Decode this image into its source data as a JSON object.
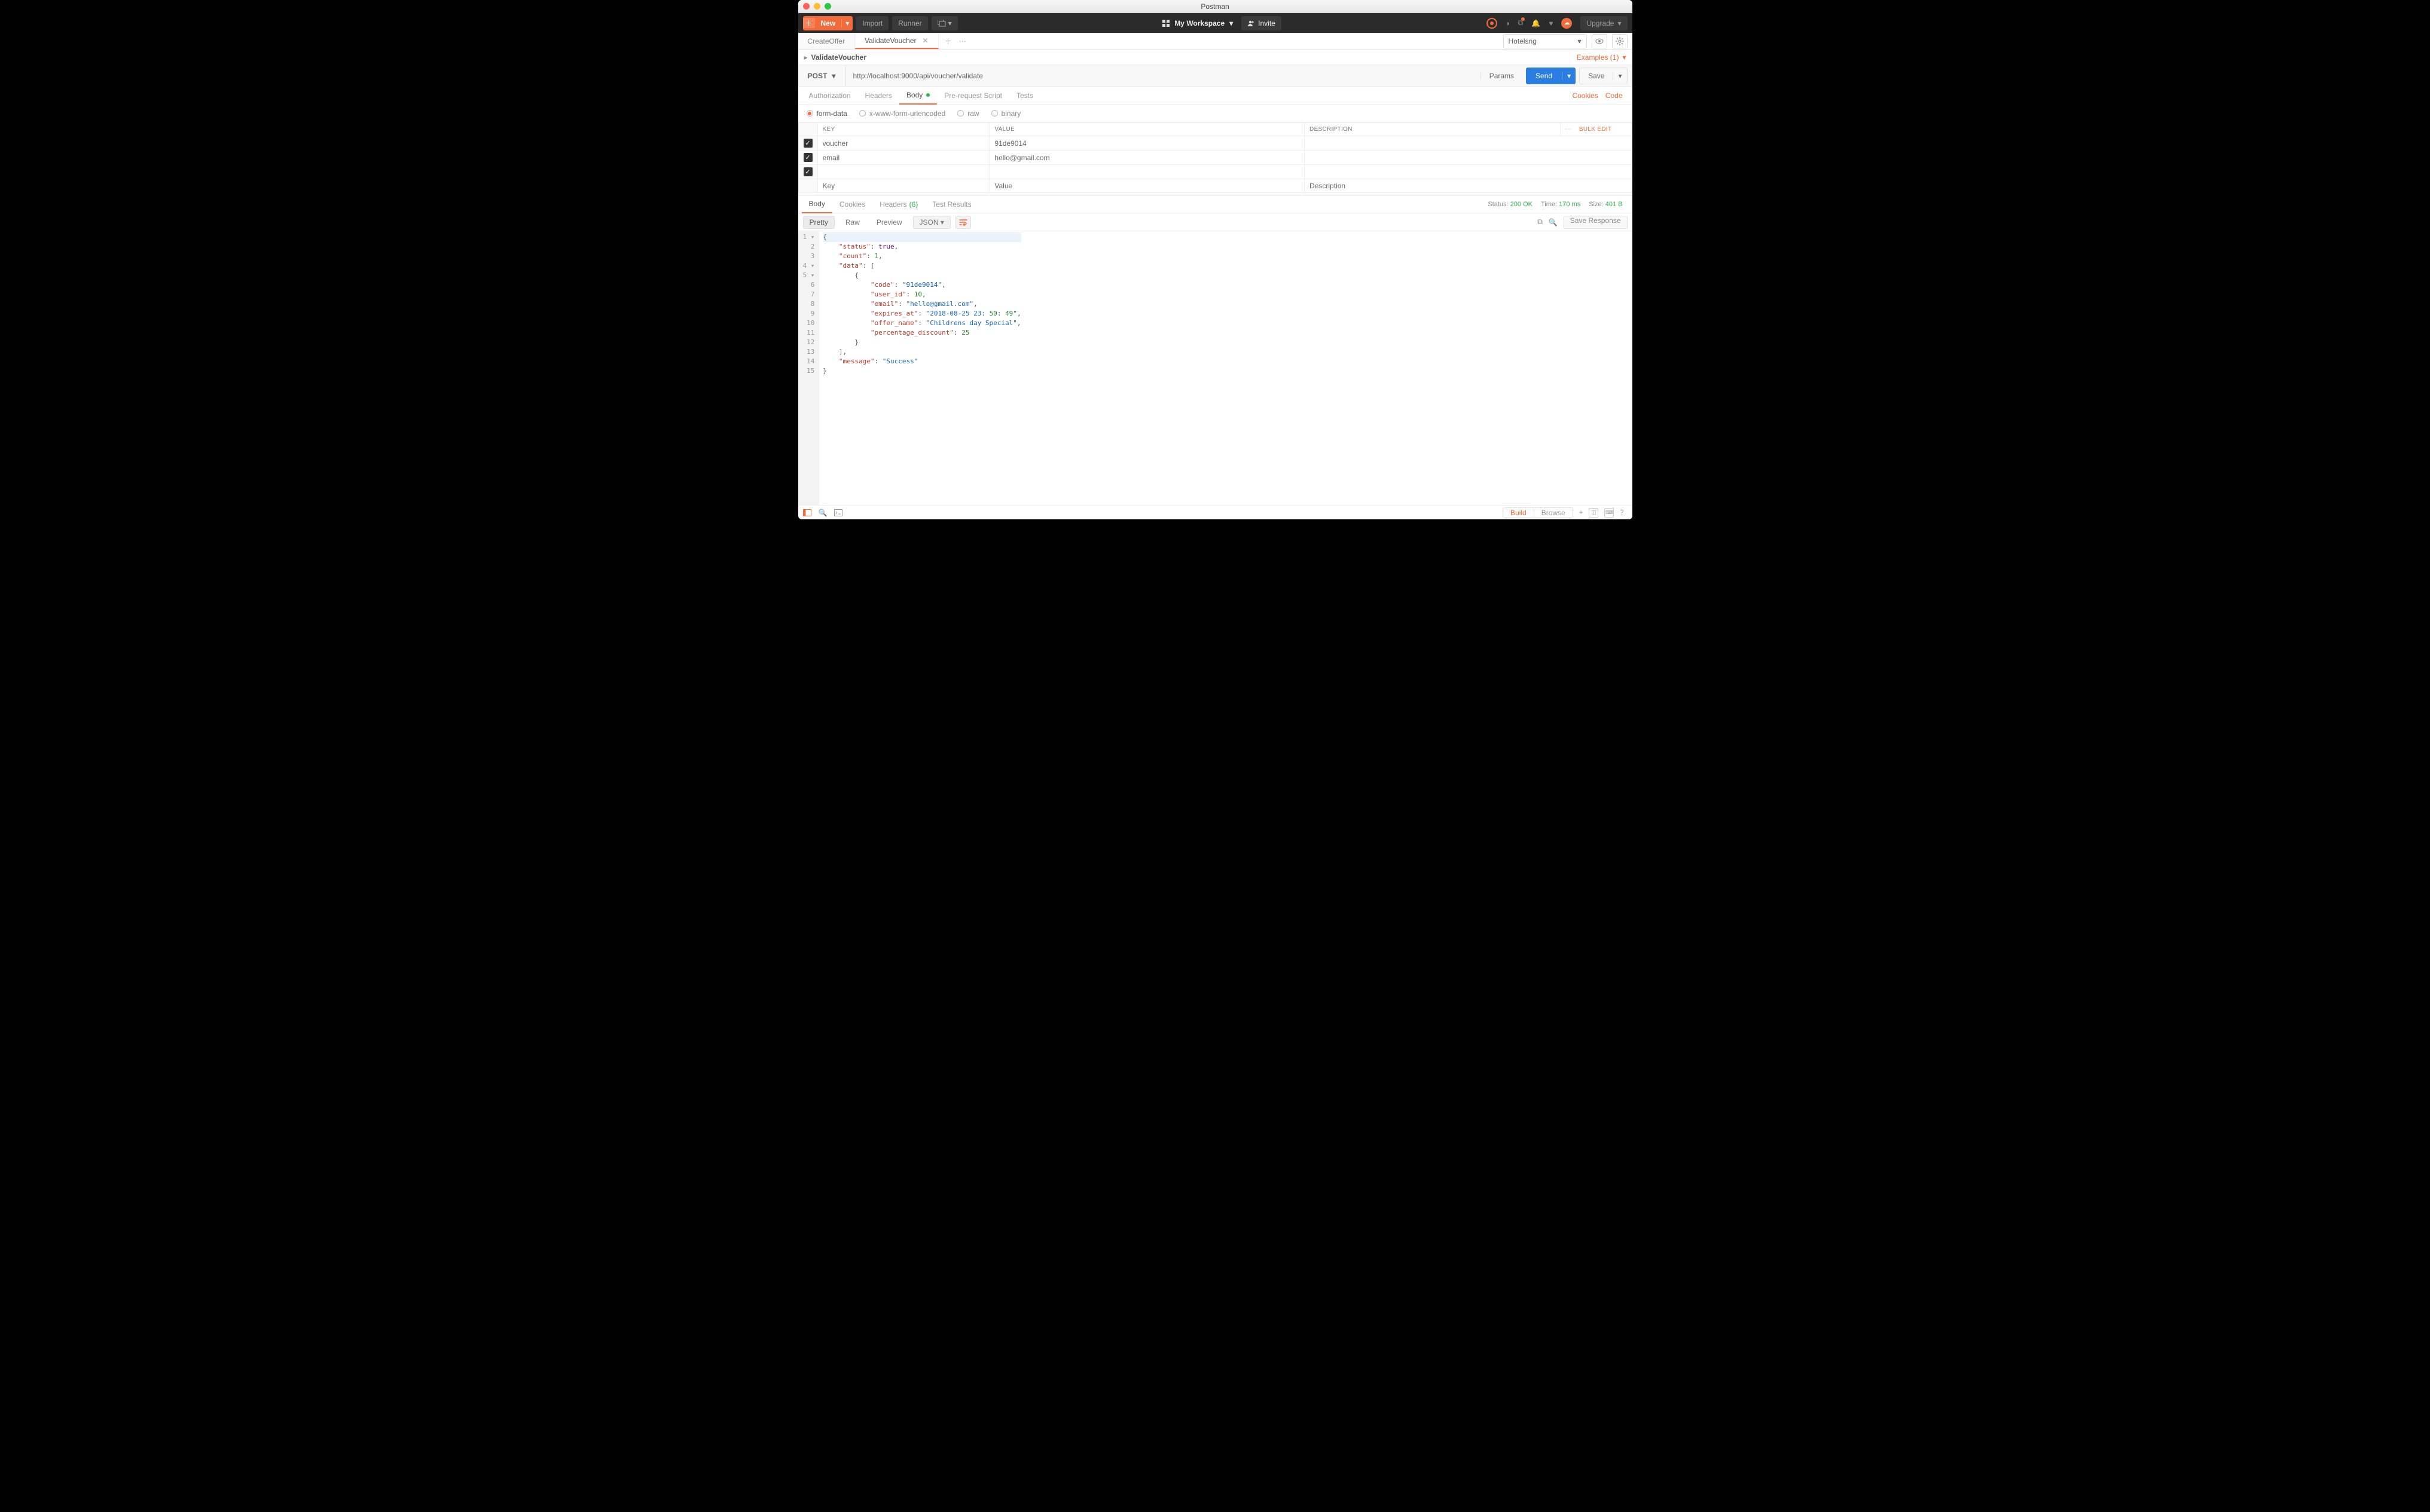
{
  "window": {
    "title": "Postman"
  },
  "topbar": {
    "new_label": "New",
    "import_label": "Import",
    "runner_label": "Runner",
    "workspace_label": "My Workspace",
    "invite_label": "Invite",
    "upgrade_label": "Upgrade"
  },
  "tabs": {
    "items": [
      {
        "label": "CreateOffer",
        "active": false
      },
      {
        "label": "ValidateVoucher",
        "active": true
      }
    ]
  },
  "env": {
    "selected": "Hotelsng"
  },
  "breadcrumb": {
    "title": "ValidateVoucher"
  },
  "examples": {
    "label": "Examples (1)"
  },
  "request": {
    "method": "POST",
    "url": "http://localhost:9000/api/voucher/validate",
    "params_label": "Params",
    "send_label": "Send",
    "save_label": "Save"
  },
  "reqtabs": {
    "authorization": "Authorization",
    "headers": "Headers",
    "body": "Body",
    "prerequest": "Pre-request Script",
    "tests": "Tests",
    "cookies": "Cookies",
    "code": "Code"
  },
  "bodytypes": {
    "form_data": "form-data",
    "x_www": "x-www-form-urlencoded",
    "raw": "raw",
    "binary": "binary"
  },
  "kvtable": {
    "headers": {
      "key": "KEY",
      "value": "VALUE",
      "description": "DESCRIPTION",
      "bulk": "Bulk Edit"
    },
    "rows": [
      {
        "key": "voucher",
        "value": "91de9014",
        "description": ""
      },
      {
        "key": "email",
        "value": "hello@gmail.com",
        "description": ""
      },
      {
        "key": "",
        "value": "",
        "description": ""
      }
    ],
    "placeholders": {
      "key": "Key",
      "value": "Value",
      "description": "Description"
    }
  },
  "resptabs": {
    "body": "Body",
    "cookies": "Cookies",
    "headers": "Headers",
    "headers_count": "(6)",
    "test_results": "Test Results"
  },
  "status": {
    "label": "Status:",
    "value": "200 OK",
    "time_label": "Time:",
    "time_value": "170 ms",
    "size_label": "Size:",
    "size_value": "401 B"
  },
  "viewbar": {
    "pretty": "Pretty",
    "raw": "Raw",
    "preview": "Preview",
    "format": "JSON",
    "save_response": "Save Response"
  },
  "response_json": {
    "status": true,
    "count": 1,
    "data": [
      {
        "code": "91de9014",
        "user_id": 10,
        "email": "hello@gmail.com",
        "expires_at": "2018-08-25 23:50:49",
        "offer_name": "Childrens day Special",
        "percentage_discount": 25
      }
    ],
    "message": "Success"
  },
  "response_lines": [
    "{",
    "    \"status\": true,",
    "    \"count\": 1,",
    "    \"data\": [",
    "        {",
    "            \"code\": \"91de9014\",",
    "            \"user_id\": 10,",
    "            \"email\": \"hello@gmail.com\",",
    "            \"expires_at\": \"2018-08-25 23:50:49\",",
    "            \"offer_name\": \"Childrens day Special\",",
    "            \"percentage_discount\": 25",
    "        }",
    "    ],",
    "    \"message\": \"Success\"",
    "}"
  ],
  "fold_lines": [
    1,
    4,
    5
  ],
  "bottombar": {
    "build": "Build",
    "browse": "Browse"
  }
}
